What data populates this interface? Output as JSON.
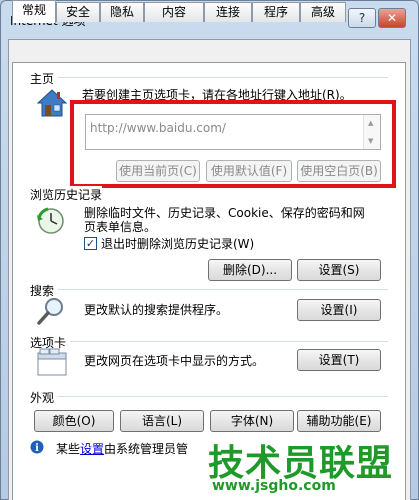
{
  "window": {
    "title": "Internet 选项",
    "help_label": "?",
    "close_label": "✕"
  },
  "tabs": [
    "常规",
    "安全",
    "隐私",
    "内容",
    "连接",
    "程序",
    "高级"
  ],
  "home": {
    "section": "主页",
    "description": "若要创建主页选项卡，请在各地址行键入地址(R)。",
    "url": "http://www.baidu.com/",
    "use_current": "使用当前页(C)",
    "use_default": "使用默认值(F)",
    "use_blank": "使用空白页(B)"
  },
  "history": {
    "section": "浏览历史记录",
    "description_line1": "删除临时文件、历史记录、Cookie、保存的密码和网",
    "description_line2": "页表单信息。",
    "checkbox_label": "退出时删除浏览历史记录(W)",
    "checkbox_mark": "✓",
    "delete_label": "删除(D)...",
    "settings_label": "设置(S)"
  },
  "search": {
    "section": "搜索",
    "description": "更改默认的搜索提供程序。",
    "settings_label": "设置(I)"
  },
  "tabs_section": {
    "section": "选项卡",
    "description": "更改网页在选项卡中显示的方式。",
    "settings_label": "设置(T)"
  },
  "appearance": {
    "section": "外观",
    "colors": "颜色(O)",
    "languages": "语言(L)",
    "fonts": "字体(N)",
    "accessibility": "辅助功能(E)"
  },
  "info": {
    "prefix": "某些",
    "link": "设置",
    "suffix": "由系统管理员管"
  },
  "watermark": {
    "text": "技术员联盟",
    "url": "www.jsgho.com"
  }
}
